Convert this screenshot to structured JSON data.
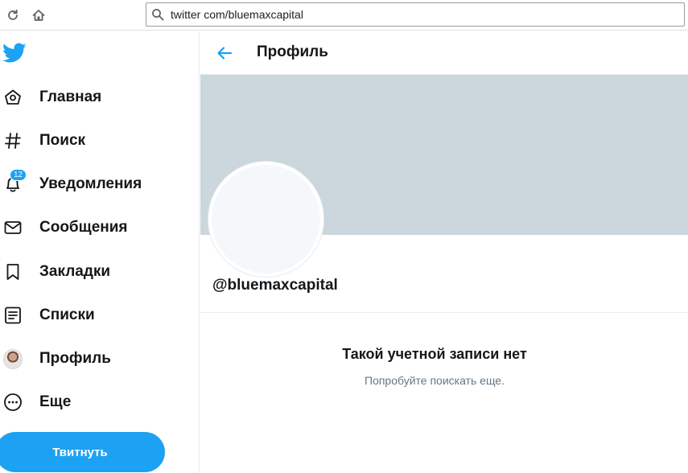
{
  "browser": {
    "url": "twitter com/bluemaxcapital"
  },
  "sidebar": {
    "items": [
      {
        "label": "Главная",
        "icon": "home-icon"
      },
      {
        "label": "Поиск",
        "icon": "hashtag-icon"
      },
      {
        "label": "Уведомления",
        "icon": "bell-icon",
        "badge": "12"
      },
      {
        "label": "Сообщения",
        "icon": "envelope-icon"
      },
      {
        "label": "Закладки",
        "icon": "bookmark-icon"
      },
      {
        "label": "Списки",
        "icon": "list-icon"
      },
      {
        "label": "Профиль",
        "icon": "avatar"
      },
      {
        "label": "Еще",
        "icon": "more-icon"
      }
    ],
    "tweet_label": "Твитнуть"
  },
  "main": {
    "header_title": "Профиль",
    "handle": "@bluemaxcapital",
    "empty_title": "Такой учетной записи нет",
    "empty_subtitle": "Попробуйте поискать еще."
  },
  "colors": {
    "accent": "#1da1f2",
    "banner": "#ccd6dd",
    "text": "#14171a",
    "muted": "#657786"
  }
}
